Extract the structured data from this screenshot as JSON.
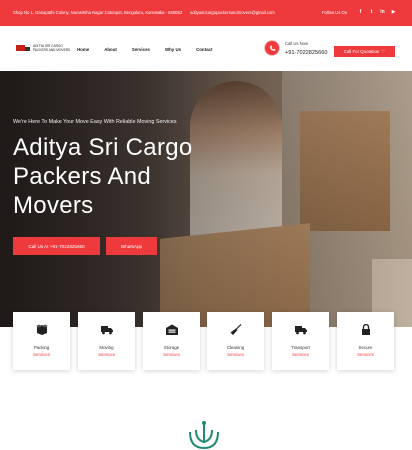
{
  "topbar": {
    "address": "Shop No 1, Ganapathi Colony, Narasimha Nagar Cotonpet, Bengaluru, Karnataka - 560053",
    "email": "adityasricargopackersandmovers@gmail.com",
    "follow_label": "Follow Us On",
    "social": [
      {
        "icon": "facebook-icon",
        "glyph": "f"
      },
      {
        "icon": "twitter-icon",
        "glyph": "t"
      },
      {
        "icon": "linkedin-icon",
        "glyph": "in"
      },
      {
        "icon": "youtube-icon",
        "glyph": "▶"
      }
    ]
  },
  "header": {
    "logo_text_line1": "ADITYA SRI CARGO",
    "logo_text_line2": "PACKERS AND MOVERS",
    "nav": [
      "Home",
      "About",
      "Services",
      "Why Us",
      "Contact"
    ],
    "call_label": "Call Us Now",
    "call_number": "+91-7022825660",
    "quote_button": "Call For Quotation",
    "quote_icon": "heart-icon"
  },
  "hero": {
    "tagline": "We're Here To Make Your Move Easy With Reliable Moving Services",
    "title_lines": [
      "Aditya Sri Cargo",
      "Packers And",
      "Movers"
    ],
    "call_button": "Call Us At +91-7022825660",
    "whatsapp_button": "WhatsApp"
  },
  "services": [
    {
      "line1": "Packing",
      "line2": "Services",
      "icon": "open-box-icon"
    },
    {
      "line1": "Moving",
      "line2": "Services",
      "icon": "truck-icon"
    },
    {
      "line1": "Storage",
      "line2": "Services",
      "icon": "warehouse-icon"
    },
    {
      "line1": "Cleaning",
      "line2": "Services",
      "icon": "broom-icon"
    },
    {
      "line1": "Transport",
      "line2": "Services",
      "icon": "truck-icon"
    },
    {
      "line1": "Secure",
      "line2": "Services",
      "icon": "lock-icon"
    }
  ],
  "colors": {
    "accent": "#ee3a3c",
    "text": "#1c1c1c",
    "emblem": "#1f8b73"
  }
}
